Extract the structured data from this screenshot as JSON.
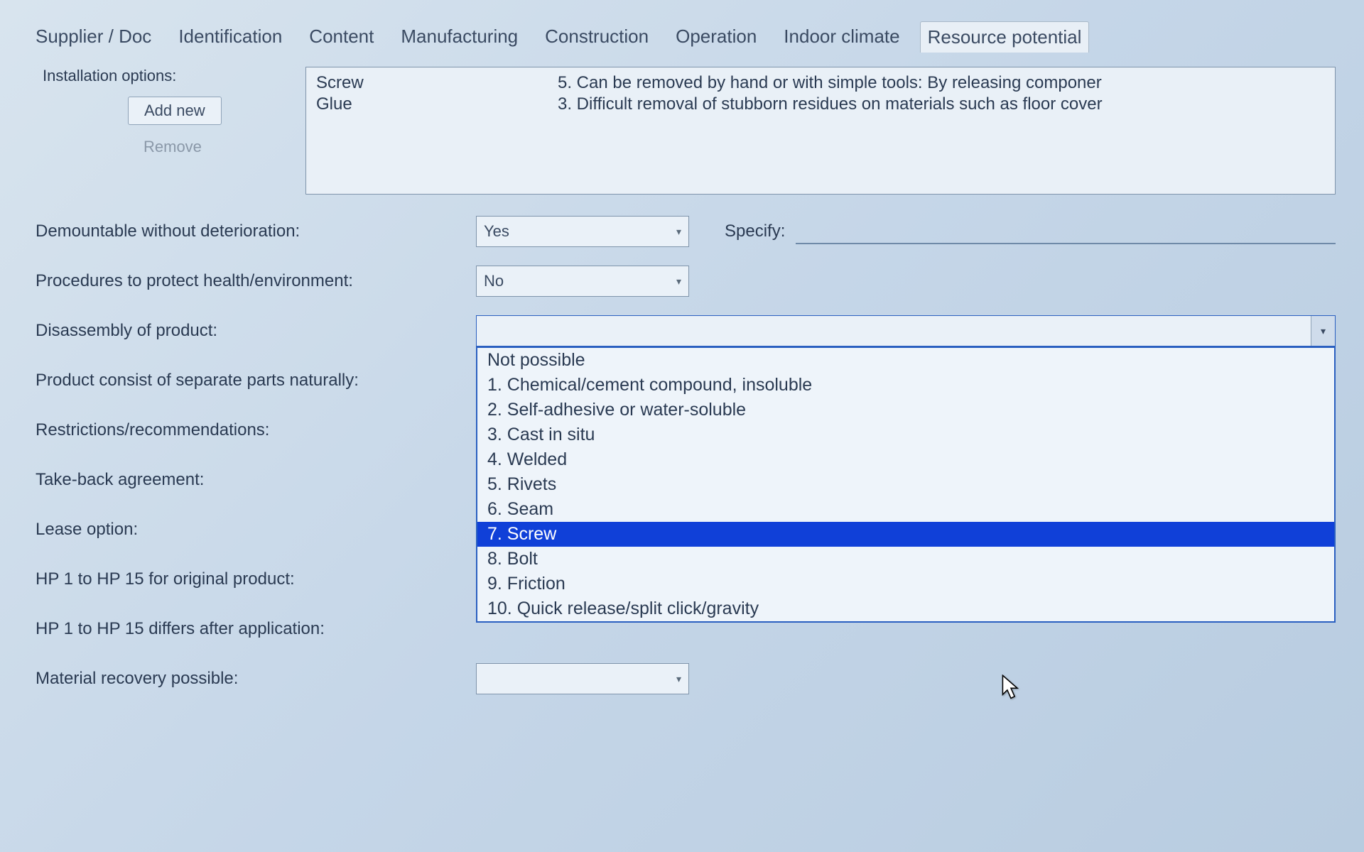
{
  "tabs": {
    "t0": "Supplier / Doc",
    "t1": "Identification",
    "t2": "Content",
    "t3": "Manufacturing",
    "t4": "Construction",
    "t5": "Operation",
    "t6": "Indoor climate",
    "t7": "Resource potential"
  },
  "install": {
    "label": "Installation options:",
    "add": "Add new",
    "remove": "Remove",
    "col1": {
      "a": "Screw",
      "b": "Glue"
    },
    "col2": {
      "a": "5. Can be removed by hand or with simple tools: By releasing componer",
      "b": "3. Difficult removal of stubborn residues on materials such as floor cover"
    }
  },
  "rows": {
    "demount": {
      "label": "Demountable without deterioration:",
      "value": "Yes",
      "specify": "Specify:"
    },
    "procedures": {
      "label": "Procedures to protect health/environment:",
      "value": "No"
    },
    "disassembly": {
      "label": "Disassembly of product:"
    },
    "separate": {
      "label": "Product consist of separate parts naturally:"
    },
    "restrict": {
      "label": "Restrictions/recommendations:"
    },
    "takeback": {
      "label": "Take-back agreement:"
    },
    "lease": {
      "label": "Lease option:"
    },
    "hp1": {
      "label": "HP 1 to HP 15 for original product:"
    },
    "hp2": {
      "label": "HP 1 to HP 15 differs after application:"
    },
    "material": {
      "label": "Material recovery possible:"
    }
  },
  "dropdown": {
    "o0": "Not possible",
    "o1": "1. Chemical/cement compound, insoluble",
    "o2": "2. Self-adhesive or water-soluble",
    "o3": "3. Cast in situ",
    "o4": "4. Welded",
    "o5": "5. Rivets",
    "o6": "6. Seam",
    "o7": "7. Screw",
    "o8": "8. Bolt",
    "o9": "9. Friction",
    "o10": "10. Quick release/split click/gravity"
  }
}
